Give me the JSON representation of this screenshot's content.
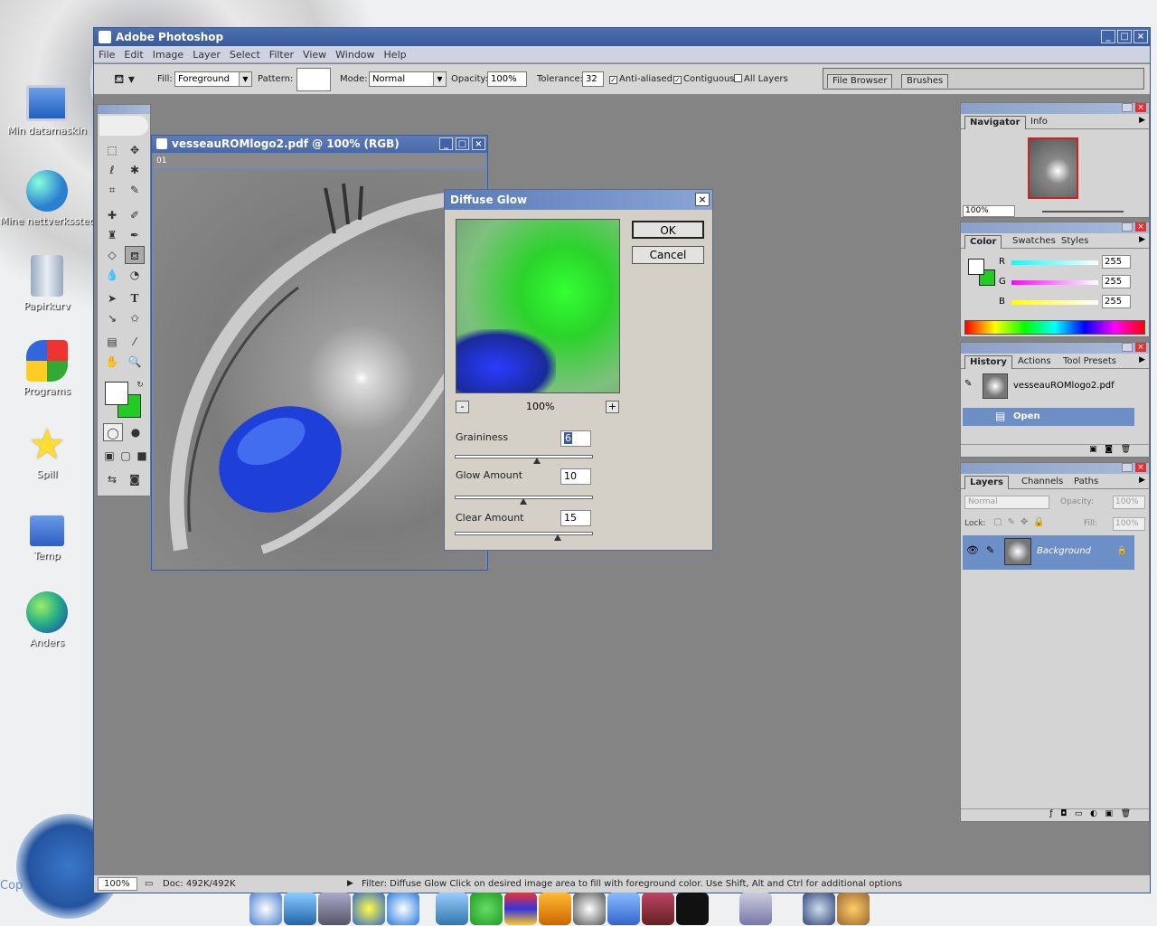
{
  "desktop": {
    "icons": [
      {
        "label": "Min datamaskin",
        "icon": "computer-icon"
      },
      {
        "label": "Mine nettverkssteder",
        "icon": "network-icon"
      },
      {
        "label": "Papirkurv",
        "icon": "recycle-bin-icon"
      },
      {
        "label": "Programs",
        "icon": "windows-logo-icon"
      },
      {
        "label": "Spill",
        "icon": "star-icon"
      },
      {
        "label": "Temp",
        "icon": "folder-icon"
      },
      {
        "label": "Anders",
        "icon": "globe-icon"
      }
    ],
    "corner_text": "Cop"
  },
  "window": {
    "title": "Adobe Photoshop"
  },
  "menu": [
    "File",
    "Edit",
    "Image",
    "Layer",
    "Select",
    "Filter",
    "View",
    "Window",
    "Help"
  ],
  "options": {
    "fill_label": "Fill:",
    "fill_value": "Foreground",
    "pattern_label": "Pattern:",
    "mode_label": "Mode:",
    "mode_value": "Normal",
    "opacity_label": "Opacity:",
    "opacity_value": "100%",
    "tolerance_label": "Tolerance:",
    "tolerance_value": "32",
    "antialiased": "Anti-aliased",
    "contiguous": "Contiguous",
    "all_layers": "All Layers",
    "well_tabs": [
      "File Browser",
      "Brushes"
    ]
  },
  "document": {
    "title": "vesseauROMlogo2.pdf @ 100% (RGB)",
    "badge": "01"
  },
  "dialog": {
    "title": "Diffuse Glow",
    "ok": "OK",
    "cancel": "Cancel",
    "zoom": "100%",
    "minus": "-",
    "plus": "+",
    "graininess_label": "Graininess",
    "graininess_value": "6",
    "glow_label": "Glow Amount",
    "glow_value": "10",
    "clear_label": "Clear Amount",
    "clear_value": "15",
    "sliders": {
      "graininess": 0.6,
      "glow": 0.5,
      "clear": 0.75
    }
  },
  "navigator": {
    "tabs": [
      "Navigator",
      "Info"
    ],
    "zoom": "100%"
  },
  "color": {
    "tabs": [
      "Color",
      "Swatches",
      "Styles"
    ],
    "r_label": "R",
    "r": "255",
    "g_label": "G",
    "g": "255",
    "b_label": "B",
    "b": "255"
  },
  "history": {
    "tabs": [
      "History",
      "Actions",
      "Tool Presets"
    ],
    "snapshot": "vesseauROMlogo2.pdf",
    "step": "Open"
  },
  "layers": {
    "tabs": [
      "Layers",
      "Channels",
      "Paths"
    ],
    "blend": "Normal",
    "opacity_label": "Opacity:",
    "opacity": "100%",
    "lock_label": "Lock:",
    "fill_label": "Fill:",
    "fill": "100%",
    "layer": "Background"
  },
  "status": {
    "zoom": "100%",
    "doc": "Doc: 492K/492K",
    "message": "Filter: Diffuse Glow   Click on desired image area to fill with foreground color.  Use Shift, Alt and Ctrl for additional options"
  }
}
